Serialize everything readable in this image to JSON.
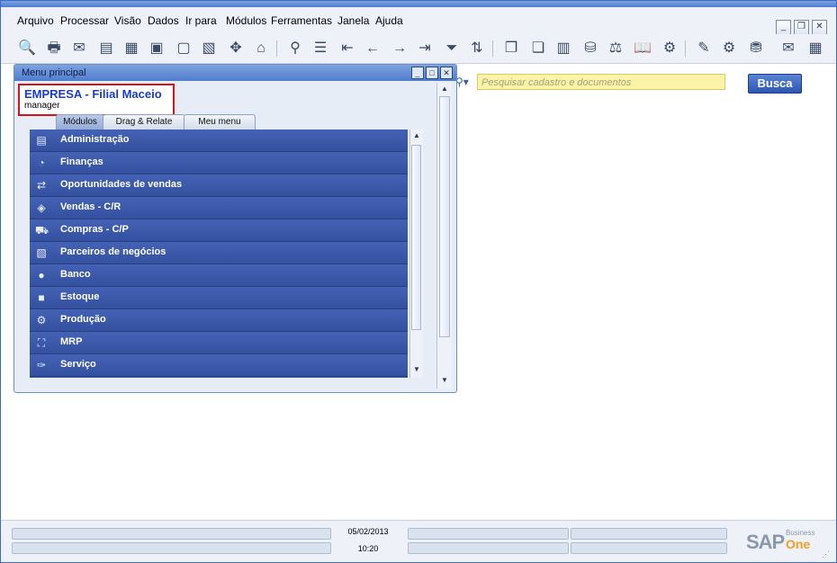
{
  "menubar": {
    "items": [
      "Arquivo",
      "Processar",
      "Visão",
      "Dados",
      "Ir para",
      "Módulos",
      "Ferramentas",
      "Janela",
      "Ajuda"
    ]
  },
  "window_controls": {
    "minimize": "_",
    "restore": "❐",
    "close": "✕"
  },
  "search": {
    "placeholder": "Pesquisar cadastro e documentos",
    "button_label": "Busca"
  },
  "main_menu": {
    "title": "Menu principal",
    "company": "EMPRESA - Filial Maceio",
    "user": "manager",
    "tabs": [
      "Módulos",
      "Drag & Relate",
      "Meu menu"
    ],
    "modules": [
      {
        "label": "Administração",
        "icon": "administration-icon"
      },
      {
        "label": "Finanças",
        "icon": "finance-icon"
      },
      {
        "label": "Oportunidades de vendas",
        "icon": "opportunities-icon"
      },
      {
        "label": "Vendas - C/R",
        "icon": "sales-icon"
      },
      {
        "label": "Compras - C/P",
        "icon": "purchasing-icon"
      },
      {
        "label": "Parceiros de negócios",
        "icon": "business-partners-icon"
      },
      {
        "label": "Banco",
        "icon": "banking-icon"
      },
      {
        "label": "Estoque",
        "icon": "inventory-icon"
      },
      {
        "label": "Produção",
        "icon": "production-icon"
      },
      {
        "label": "MRP",
        "icon": "mrp-icon"
      },
      {
        "label": "Serviço",
        "icon": "service-icon"
      }
    ]
  },
  "status": {
    "date": "05/02/2013",
    "time": "10:20"
  },
  "logo": {
    "brand": "SAP",
    "line1": "Business",
    "line2": "One"
  },
  "colors": {
    "module_bg": "#3b57a8",
    "accent": "#2c56b2",
    "company_text": "#1d3cc6",
    "highlight_border": "#d41515",
    "search_bg": "#fbf3a8",
    "logo_orange": "#f0a020"
  }
}
